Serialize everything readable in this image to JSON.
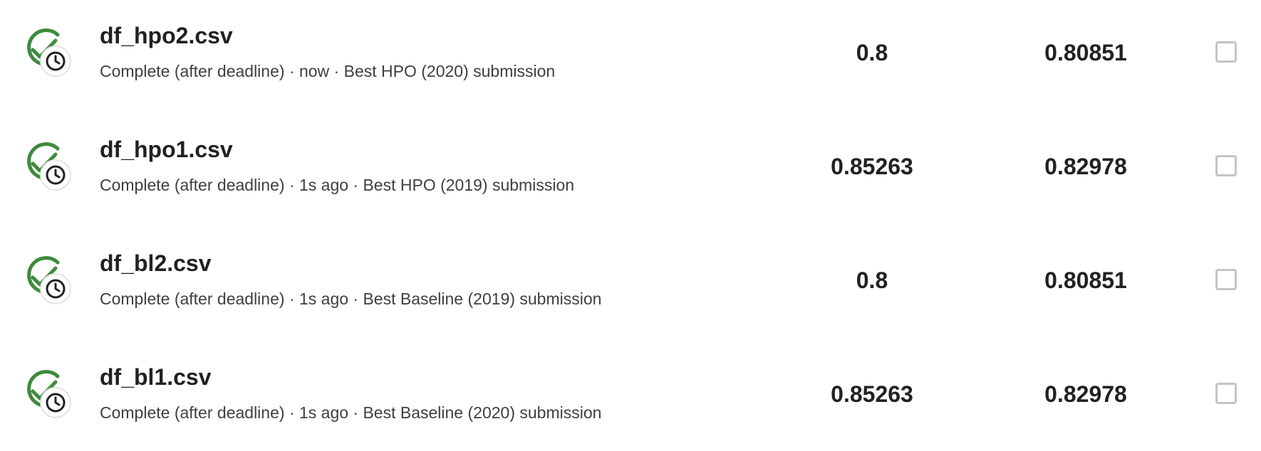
{
  "colors": {
    "success_green": "#3d8b3d",
    "text_primary": "#202124",
    "text_secondary": "#3c4043",
    "checkbox_border": "#c4c4c4"
  },
  "submissions": [
    {
      "file_name": "df_hpo2.csv",
      "meta": "Complete (after deadline) · now · Best HPO (2020) submission",
      "private_score": "0.8",
      "public_score": "0.80851",
      "status_icon": "check-circle-icon",
      "late_icon": "clock-icon",
      "selected": false
    },
    {
      "file_name": "df_hpo1.csv",
      "meta": "Complete (after deadline) · 1s ago · Best HPO (2019) submission",
      "private_score": "0.85263",
      "public_score": "0.82978",
      "status_icon": "check-circle-icon",
      "late_icon": "clock-icon",
      "selected": false
    },
    {
      "file_name": "df_bl2.csv",
      "meta": "Complete (after deadline) · 1s ago · Best Baseline (2019) submission",
      "private_score": "0.8",
      "public_score": "0.80851",
      "status_icon": "check-circle-icon",
      "late_icon": "clock-icon",
      "selected": false
    },
    {
      "file_name": "df_bl1.csv",
      "meta": "Complete (after deadline) · 1s ago · Best Baseline (2020) submission",
      "private_score": "0.85263",
      "public_score": "0.82978",
      "status_icon": "check-circle-icon",
      "late_icon": "clock-icon",
      "selected": false
    }
  ]
}
